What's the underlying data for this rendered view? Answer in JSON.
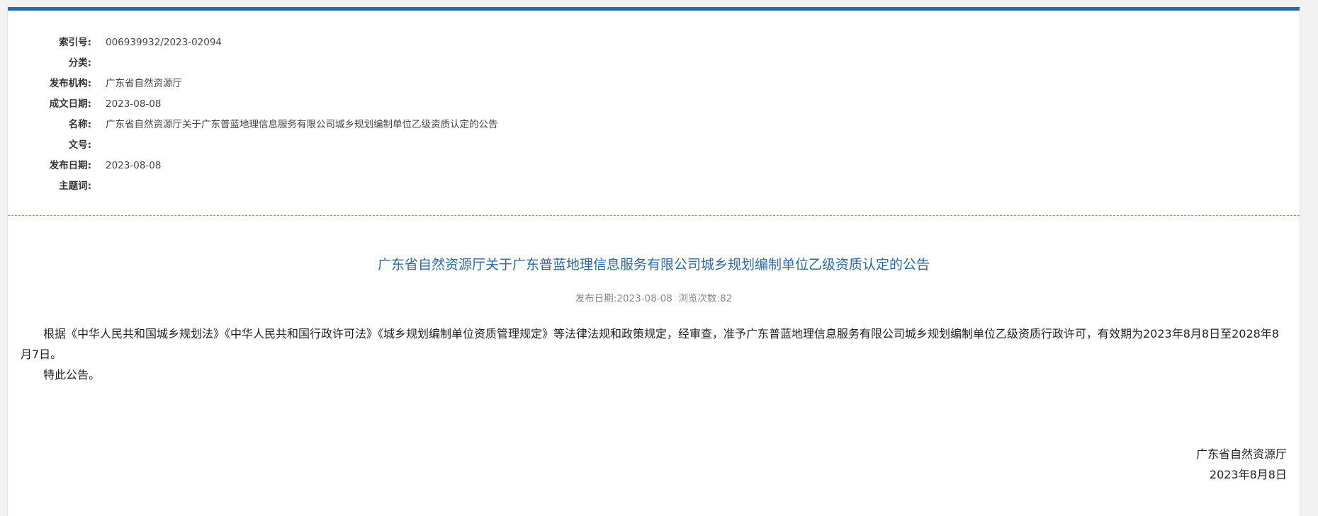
{
  "metadata": {
    "index_no": {
      "label": "索引号:",
      "value": "006939932/2023-02094"
    },
    "category": {
      "label": "分类:",
      "value": ""
    },
    "publisher": {
      "label": "发布机构:",
      "value": "广东省自然资源厅"
    },
    "created_date": {
      "label": "成文日期:",
      "value": "2023-08-08"
    },
    "name": {
      "label": "名称:",
      "value": "广东省自然资源厅关于广东普蓝地理信息服务有限公司城乡规划编制单位乙级资质认定的公告"
    },
    "doc_no": {
      "label": "文号:",
      "value": ""
    },
    "publish_date": {
      "label": "发布日期:",
      "value": "2023-08-08"
    },
    "keywords": {
      "label": "主题词:",
      "value": ""
    }
  },
  "article": {
    "title": "广东省自然资源厅关于广东普蓝地理信息服务有限公司城乡规划编制单位乙级资质认定的公告",
    "publish_label": "发布日期:",
    "publish_date": "2023-08-08",
    "views_label": "浏览次数:",
    "views": "82",
    "paragraphs": [
      "根据《中华人民共和国城乡规划法》《中华人民共和国行政许可法》《城乡规划编制单位资质管理规定》等法律法规和政策规定，经审查，准予广东普蓝地理信息服务有限公司城乡规划编制单位乙级资质行政许可，有效期为2023年8月8日至2028年8月7日。",
      "特此公告。"
    ],
    "signature_org": "广东省自然资源厅",
    "signature_date": "2023年8月8日"
  },
  "colors": {
    "accent": "#2b6aa7",
    "divider": "#6f9fd0"
  }
}
